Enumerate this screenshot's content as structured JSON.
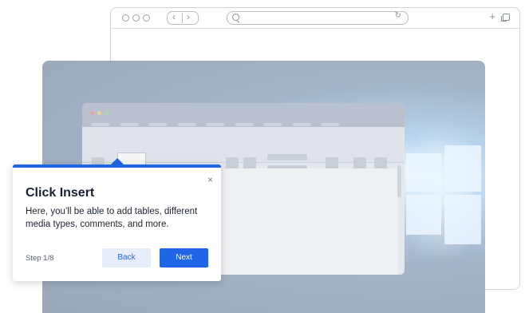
{
  "tooltip": {
    "title": "Click Insert",
    "body": "Here, you’ll be able to add tables, different media types, comments, and more.",
    "step": "Step 1/8",
    "back_label": "Back",
    "next_label": "Next",
    "close_glyph": "×"
  },
  "browser": {
    "nav_back": "‹",
    "nav_forward": "›",
    "reload_glyph": "↻",
    "new_tab_glyph": "+"
  },
  "colors": {
    "accent": "#1f66e6"
  }
}
